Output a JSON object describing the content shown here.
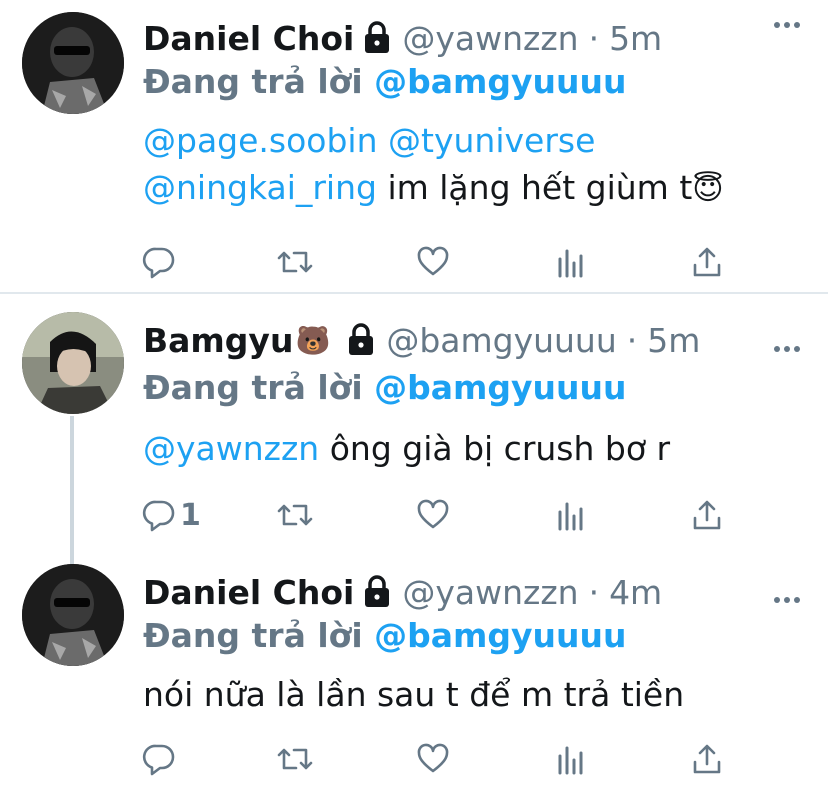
{
  "tweets": [
    {
      "name": "Daniel Choi",
      "name_emoji": "",
      "handle": "@yawnzzn",
      "separator": "·",
      "time": "5m",
      "reply_prefix": "Đang trả lời",
      "reply_mention": "@bamgyuuuu",
      "line1_mention_a": "@page.soobin",
      "line1_mention_b": "@tyuniverse",
      "line2_mention": "@ningkai_ring",
      "line2_text": " im lặng hết giùm t",
      "line2_emoji": "😇",
      "reply_count": ""
    },
    {
      "name": "Bamgyu",
      "name_emoji": "🐻",
      "handle": "@bamgyuuuu",
      "separator": "·",
      "time": "5m",
      "reply_prefix": "Đang trả lời",
      "reply_mention": "@bamgyuuuu",
      "line1_mention": "@yawnzzn",
      "line1_text": " ông già bị crush bơ r",
      "reply_count": "1"
    },
    {
      "name": "Daniel Choi",
      "name_emoji": "",
      "handle": "@yawnzzn",
      "separator": "·",
      "time": "4m",
      "reply_prefix": "Đang trả lời",
      "reply_mention": "@bamgyuuuu",
      "line1_text": "nói nữa là lần sau t để m trả tiền",
      "reply_count": ""
    }
  ],
  "icons": {
    "more": "more-horizontal-icon",
    "lock": "lock-icon",
    "reply": "reply-icon",
    "retweet": "retweet-icon",
    "like": "heart-icon",
    "analytics": "analytics-icon",
    "share": "share-icon"
  },
  "colors": {
    "link": "#1da1f2",
    "secondary": "#657786",
    "text": "#14171a",
    "divider": "#e1e8ed"
  }
}
